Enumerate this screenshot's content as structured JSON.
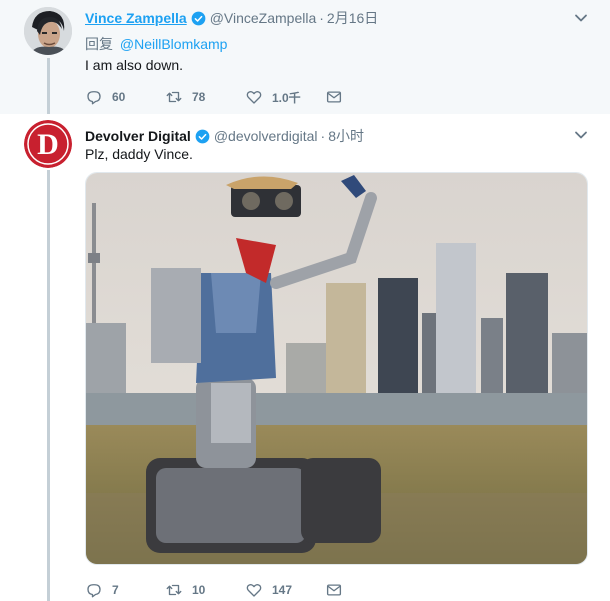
{
  "tweet1": {
    "name": "Vince Zampella",
    "handle": "@VinceZampella",
    "separator": "·",
    "time": "2月16日",
    "reply_prefix": "回复",
    "reply_mention": "@NeillBlomkamp",
    "text": "I am also down.",
    "replies": "60",
    "retweets": "78",
    "likes": "1.0千"
  },
  "tweet2": {
    "name": "Devolver Digital",
    "handle": "@devolverdigital",
    "separator": "·",
    "time": "8小时",
    "text": "Plz, daddy Vince.",
    "replies": "7",
    "retweets": "10",
    "likes": "147",
    "avatar_letter": "D"
  },
  "colors": {
    "link_blue": "#1da1f2",
    "muted": "#657786",
    "thread_line": "#c4cfd6",
    "devolver_red": "#c8202f"
  }
}
